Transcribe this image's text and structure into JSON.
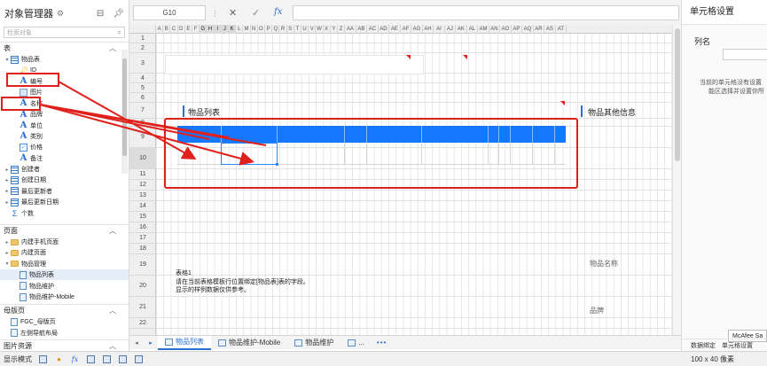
{
  "left_panel": {
    "title": "对象管理器",
    "search_placeholder": "检索对象",
    "sections": {
      "tables": "表",
      "pages": "页面",
      "master_pages": "母版页",
      "image_resources": "图片资源"
    },
    "table_tree": [
      {
        "label": "物品表",
        "icon": "table-icon",
        "indent": 0,
        "twisty": "▾"
      },
      {
        "label": "ID",
        "icon": "key-icon",
        "indent": 1
      },
      {
        "label": "编号",
        "icon": "text-field-icon",
        "indent": 1
      },
      {
        "label": "图片",
        "icon": "image-field-icon",
        "indent": 1
      },
      {
        "label": "名称",
        "icon": "text-field-icon",
        "indent": 1
      },
      {
        "label": "品牌",
        "icon": "text-field-icon",
        "indent": 1
      },
      {
        "label": "单位",
        "icon": "text-field-icon",
        "indent": 1
      },
      {
        "label": "类别",
        "icon": "text-field-icon",
        "indent": 1
      },
      {
        "label": "价格",
        "icon": "checkbox-field-icon",
        "indent": 1
      },
      {
        "label": "备注",
        "icon": "text-field-icon",
        "indent": 1
      },
      {
        "label": "创建者",
        "icon": "table-icon",
        "indent": 0,
        "twisty": "▸"
      },
      {
        "label": "创建日期",
        "icon": "table-icon",
        "indent": 0,
        "twisty": "▸"
      },
      {
        "label": "最后更新者",
        "icon": "table-icon",
        "indent": 0,
        "twisty": "▸"
      },
      {
        "label": "最后更新日期",
        "icon": "table-icon",
        "indent": 0,
        "twisty": "▸"
      },
      {
        "label": "个数",
        "icon": "sum-icon",
        "indent": 0
      }
    ],
    "page_tree": [
      {
        "label": "内建手机页面",
        "icon": "folder-icon",
        "indent": 0,
        "twisty": "▸"
      },
      {
        "label": "内建页面",
        "icon": "folder-icon",
        "indent": 0,
        "twisty": "▸"
      },
      {
        "label": "物品管理",
        "icon": "folder-icon",
        "indent": 0,
        "twisty": "▾"
      },
      {
        "label": "物品列表",
        "icon": "page-icon",
        "indent": 1,
        "selected": true
      },
      {
        "label": "物品维护",
        "icon": "page-icon",
        "indent": 1
      },
      {
        "label": "物品维护-Mobile",
        "icon": "page-icon",
        "indent": 1
      }
    ],
    "master_tree": [
      {
        "label": "FGC_母版页",
        "icon": "page-icon",
        "indent": 0
      },
      {
        "label": "左侧导航布局",
        "icon": "page-icon",
        "indent": 0
      }
    ]
  },
  "toolbar": {
    "cell_ref": "G10",
    "cancel_icon": "✕",
    "confirm_icon": "✓",
    "fx_label": "fx",
    "formula_value": ""
  },
  "sheet": {
    "columns": [
      "A",
      "B",
      "C",
      "D",
      "E",
      "F",
      "G",
      "H",
      "I",
      "J",
      "K",
      "L",
      "M",
      "N",
      "O",
      "P",
      "Q",
      "R",
      "S",
      "T",
      "U",
      "V",
      "W",
      "X",
      "Y",
      "Z",
      "AA",
      "AB",
      "AC",
      "AD",
      "AE",
      "AF",
      "AG",
      "AH",
      "AI",
      "AJ",
      "AK",
      "AL",
      "AM",
      "AN",
      "AO",
      "AP",
      "AQ",
      "AR",
      "AS",
      "AT"
    ],
    "active_columns": [
      "G",
      "H",
      "I",
      "J",
      "K"
    ],
    "rows": [
      "1",
      "2",
      "3",
      "4",
      "5",
      "6",
      "7",
      "8",
      "9",
      "10",
      "11",
      "12",
      "13",
      "14",
      "15",
      "16",
      "17",
      "18",
      "19",
      "20",
      "21",
      "22",
      "23"
    ],
    "active_row": "10",
    "list_title": "物品列表",
    "other_info_title": "物品其他信息",
    "note_lines": [
      "表格1",
      "请在当前表格模板行位置绑定[物品表]表的字段。",
      "显示的样例数据仅供参考。"
    ],
    "right_labels": {
      "name": "物品名称",
      "brand": "品牌"
    }
  },
  "tabs": [
    {
      "label": "物品列表",
      "active": true
    },
    {
      "label": "物品维护-Mobile",
      "active": false
    },
    {
      "label": "物品维护",
      "active": false
    },
    {
      "label": "...",
      "active": false
    }
  ],
  "tab_more": "•••",
  "right_panel": {
    "title": "单元格设置",
    "column_name_label": "列名",
    "column_name_value": "",
    "message_line1": "当前的单元格没有设置",
    "message_line2": "能区选择并设置你所",
    "bottom_tab1": "数据绑定",
    "bottom_tab2": "单元格设置",
    "mcafee": "McAfee Sa"
  },
  "status": {
    "mode_label": "显示模式",
    "size": "100 x 40 像素"
  },
  "colors": {
    "accent": "#2d6fd1",
    "header_blue": "#1677ff",
    "annotation_red": "#e0201b"
  }
}
